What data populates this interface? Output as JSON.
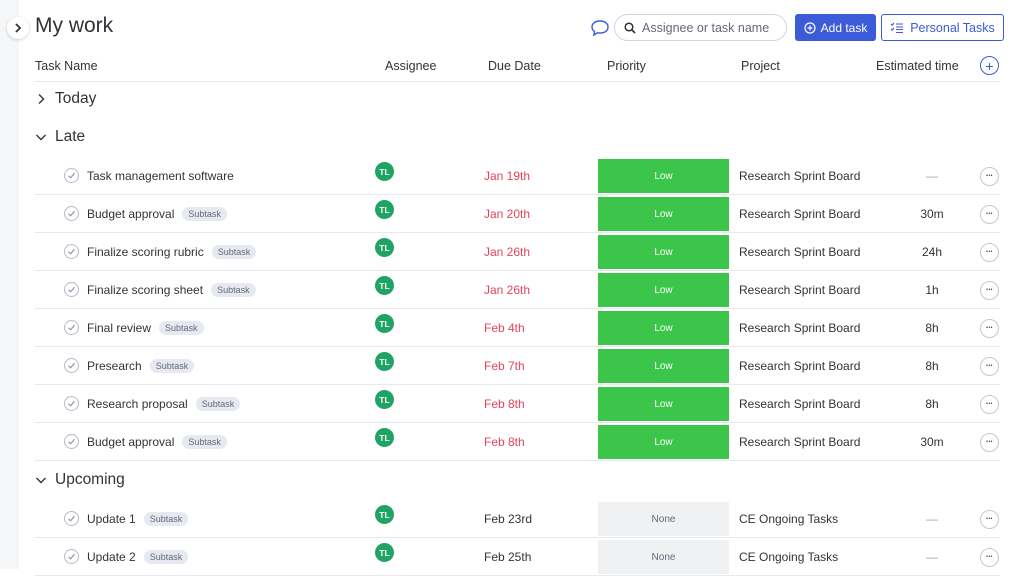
{
  "header": {
    "title": "My work",
    "search_placeholder": "Assignee or task name",
    "add_task_label": "Add task",
    "personal_tasks_label": "Personal Tasks"
  },
  "columns": {
    "task_name": "Task Name",
    "assignee": "Assignee",
    "due_date": "Due Date",
    "priority": "Priority",
    "project": "Project",
    "estimated_time": "Estimated time"
  },
  "colors": {
    "accent": "#3b5bd9",
    "low": "#3cc54b",
    "late": "#e2445c",
    "avatar": "#20a464"
  },
  "groups": {
    "today": {
      "label": "Today",
      "expanded": false
    },
    "late": {
      "label": "Late",
      "expanded": true,
      "rows": [
        {
          "name": "Task management software",
          "badge": "",
          "assignee": "TL",
          "due": "Jan 19th",
          "priority": "Low",
          "project": "Research Sprint Board",
          "est": "—"
        },
        {
          "name": "Budget approval",
          "badge": "Subtask",
          "assignee": "TL",
          "due": "Jan 20th",
          "priority": "Low",
          "project": "Research Sprint Board",
          "est": "30m"
        },
        {
          "name": "Finalize scoring rubric",
          "badge": "Subtask",
          "assignee": "TL",
          "due": "Jan 26th",
          "priority": "Low",
          "project": "Research Sprint Board",
          "est": "24h"
        },
        {
          "name": "Finalize scoring sheet",
          "badge": "Subtask",
          "assignee": "TL",
          "due": "Jan 26th",
          "priority": "Low",
          "project": "Research Sprint Board",
          "est": "1h"
        },
        {
          "name": "Final review",
          "badge": "Subtask",
          "assignee": "TL",
          "due": "Feb 4th",
          "priority": "Low",
          "project": "Research Sprint Board",
          "est": "8h"
        },
        {
          "name": "Presearch",
          "badge": "Subtask",
          "assignee": "TL",
          "due": "Feb 7th",
          "priority": "Low",
          "project": "Research Sprint Board",
          "est": "8h"
        },
        {
          "name": "Research proposal",
          "badge": "Subtask",
          "assignee": "TL",
          "due": "Feb 8th",
          "priority": "Low",
          "project": "Research Sprint Board",
          "est": "8h"
        },
        {
          "name": "Budget approval",
          "badge": "Subtask",
          "assignee": "TL",
          "due": "Feb 8th",
          "priority": "Low",
          "project": "Research Sprint Board",
          "est": "30m"
        }
      ]
    },
    "upcoming": {
      "label": "Upcoming",
      "expanded": true,
      "rows": [
        {
          "name": "Update 1",
          "badge": "Subtask",
          "assignee": "TL",
          "due": "Feb 23rd",
          "priority": "None",
          "project": "CE Ongoing Tasks",
          "est": "—"
        },
        {
          "name": "Update 2",
          "badge": "Subtask",
          "assignee": "TL",
          "due": "Feb 25th",
          "priority": "None",
          "project": "CE Ongoing Tasks",
          "est": "—"
        }
      ]
    }
  }
}
